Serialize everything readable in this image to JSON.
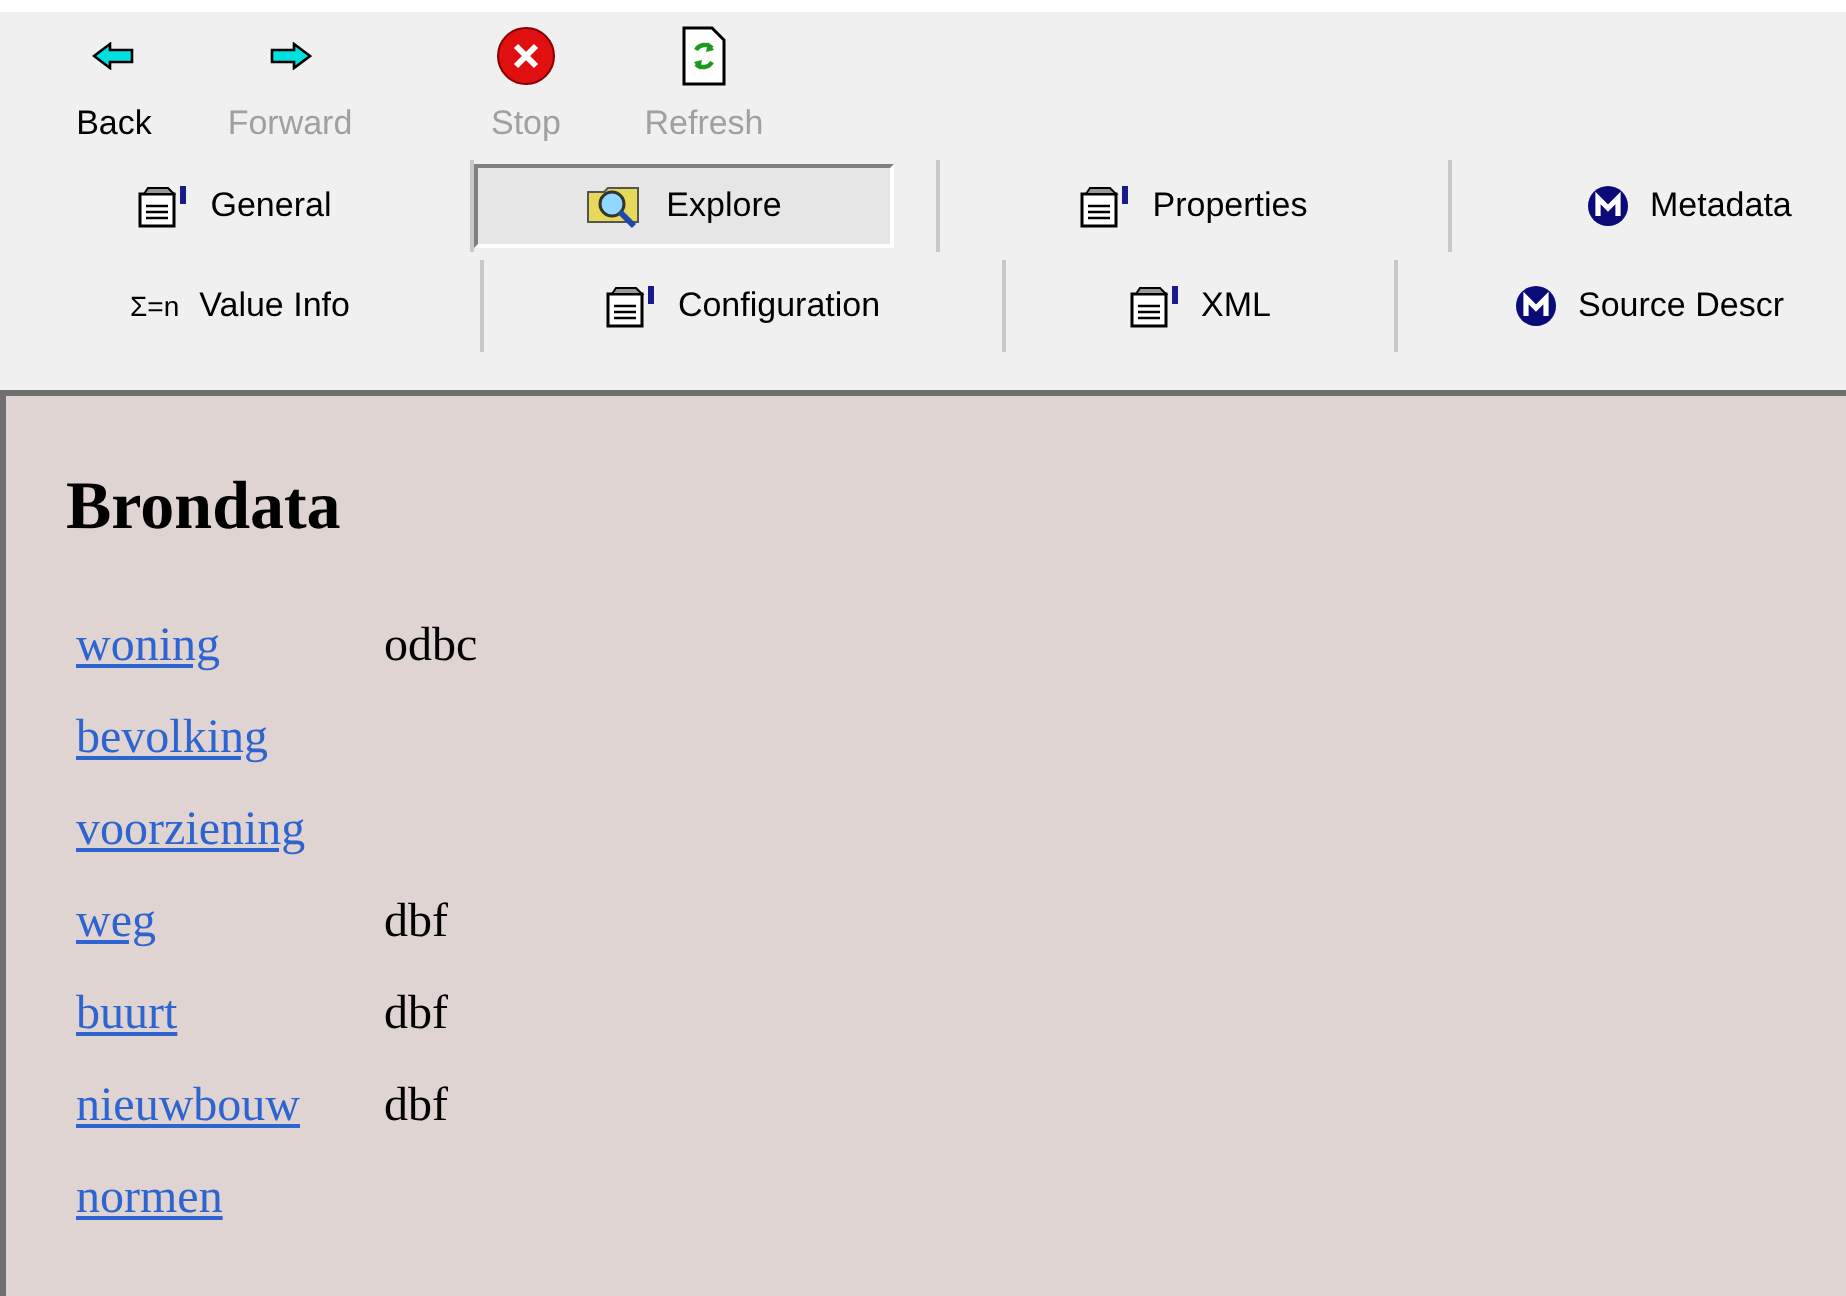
{
  "nav_buttons": [
    {
      "label": "Back",
      "kind": "back",
      "disabled": false
    },
    {
      "label": "Forward",
      "kind": "forward",
      "disabled": true
    },
    {
      "label": "Stop",
      "kind": "stop",
      "disabled": true
    },
    {
      "label": "Refresh",
      "kind": "refresh",
      "disabled": true
    }
  ],
  "tab_rows": [
    [
      {
        "label": "General",
        "kind": "sheet",
        "selected": false
      },
      {
        "label": "Explore",
        "kind": "explore",
        "selected": true
      },
      {
        "label": "Properties",
        "kind": "sheet",
        "selected": false
      },
      {
        "label": "Metadata",
        "kind": "meta",
        "selected": false
      }
    ],
    [
      {
        "label": "Value Info",
        "kind": "sigma",
        "icon_text": "Σ=n",
        "selected": false
      },
      {
        "label": "Configuration",
        "kind": "sheet",
        "selected": false
      },
      {
        "label": "XML",
        "kind": "sheet",
        "selected": false
      },
      {
        "label": "Source Descr",
        "kind": "meta",
        "selected": false
      }
    ]
  ],
  "content": {
    "heading": "Brondata",
    "rows": [
      {
        "name": "woning",
        "type": "odbc"
      },
      {
        "name": "bevolking"
      },
      {
        "name": "voorziening"
      },
      {
        "name": "weg",
        "type": "dbf"
      },
      {
        "name": "buurt",
        "type": "dbf"
      },
      {
        "name": "nieuwbouw",
        "type": "dbf"
      },
      {
        "name": "normen"
      }
    ]
  }
}
